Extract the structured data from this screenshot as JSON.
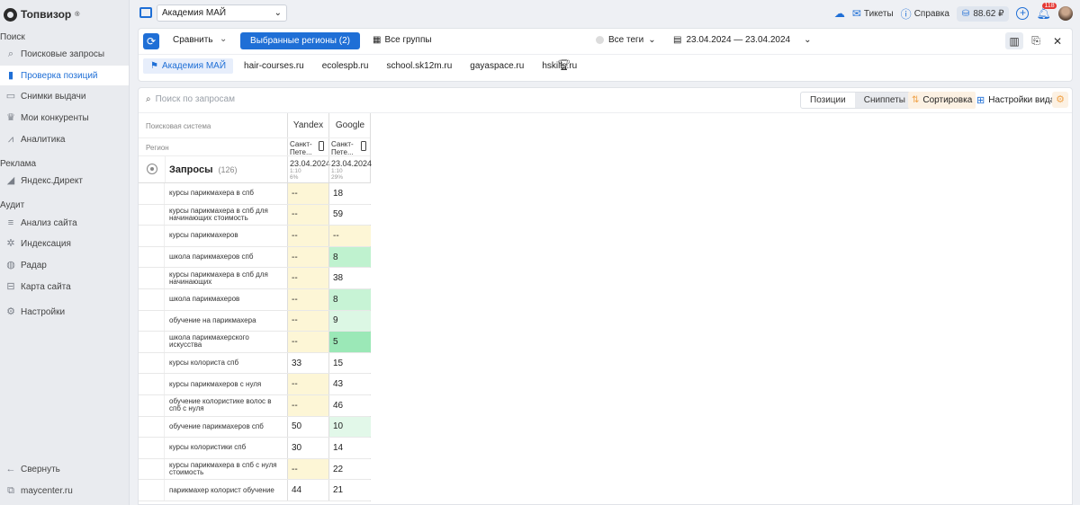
{
  "app": {
    "logo": "Топвизор",
    "logo_mark": "®"
  },
  "sidebar": {
    "sections": [
      {
        "label": "Поиск",
        "items": [
          {
            "label": "Поисковые запросы",
            "icon": "search-icon"
          },
          {
            "label": "Проверка позиций",
            "icon": "bar-chart-icon",
            "active": true
          },
          {
            "label": "Снимки выдачи",
            "icon": "snapshot-icon"
          },
          {
            "label": "Мои конкуренты",
            "icon": "trophy-icon"
          },
          {
            "label": "Аналитика",
            "icon": "analytics-icon"
          }
        ]
      },
      {
        "label": "Реклама",
        "items": [
          {
            "label": "Яндекс.Директ",
            "icon": "direct-icon"
          }
        ]
      },
      {
        "label": "Аудит",
        "items": [
          {
            "label": "Анализ сайта",
            "icon": "site-analysis-icon"
          },
          {
            "label": "Индексация",
            "icon": "indexing-icon"
          },
          {
            "label": "Радар",
            "icon": "radar-icon"
          },
          {
            "label": "Карта сайта",
            "icon": "sitemap-icon"
          }
        ]
      },
      {
        "label": "",
        "items": [
          {
            "label": "Настройки",
            "icon": "gear-icon"
          }
        ]
      }
    ],
    "collapse_label": "Свернуть",
    "site_label": "maycenter.ru"
  },
  "topbar": {
    "project": "Академия МАЙ",
    "tickets": "Тикеты",
    "help": "Справка",
    "balance": "88.62 ₽",
    "notifications": "118"
  },
  "toolbar": {
    "compare": "Сравнить",
    "regions": "Выбранные регионы",
    "regions_count": "(2)",
    "groups": "Все группы",
    "tags": "Все теги",
    "date_range": "23.04.2024 — 23.04.2024"
  },
  "project_tabs": [
    "Академия МАЙ",
    "hair-courses.ru",
    "ecolespb.ru",
    "school.sk12m.ru",
    "gayaspace.ru",
    "hskills.ru"
  ],
  "panel": {
    "search_placeholder": "Поиск по запросам",
    "seg_positions": "Позиции",
    "seg_snippets": "Сниппеты",
    "sorting": "Сортировка",
    "view_settings": "Настройки вида"
  },
  "table": {
    "header_engine": "Поисковая система",
    "header_region": "Регион",
    "engines": [
      "Yandex",
      "Google"
    ],
    "regions": [
      "Санкт-Пете...",
      "Санкт-Пете..."
    ],
    "dates": [
      "23.04.2024",
      "23.04.2024"
    ],
    "date_sub1": [
      "1:10",
      "1:10"
    ],
    "date_sub2": [
      "6%",
      "29%"
    ],
    "queries_title": "Запросы",
    "queries_count": "(126)",
    "rows": [
      {
        "q": "курсы парикмахера в спб",
        "y": "--",
        "g": "18",
        "yc": "#fdf6d6",
        "gc": "#ffffff"
      },
      {
        "q": "курсы парикмахера в спб для начинающих стоимость",
        "y": "--",
        "g": "59",
        "yc": "#fdf6d6",
        "gc": "#ffffff"
      },
      {
        "q": "курсы парикмахеров",
        "y": "--",
        "g": "--",
        "yc": "#fdf6d6",
        "gc": "#fdf6d6"
      },
      {
        "q": "школа парикмахеров спб",
        "y": "--",
        "g": "8",
        "yc": "#fdf6d6",
        "gc": "#bff2cf"
      },
      {
        "q": "курсы парикмахера в спб для начинающих",
        "y": "--",
        "g": "38",
        "yc": "#fdf6d6",
        "gc": "#ffffff"
      },
      {
        "q": "школа парикмахеров",
        "y": "--",
        "g": "8",
        "yc": "#fdf6d6",
        "gc": "#c7f3d5"
      },
      {
        "q": "обучение на парикмахера",
        "y": "--",
        "g": "9",
        "yc": "#fdf6d6",
        "gc": "#dcf7e4"
      },
      {
        "q": "школа парикмахерского искусства",
        "y": "--",
        "g": "5",
        "yc": "#fdf6d6",
        "gc": "#9be8b7"
      },
      {
        "q": "курсы колориста спб",
        "y": "33",
        "g": "15",
        "yc": "#ffffff",
        "gc": "#ffffff"
      },
      {
        "q": "курсы парикмахеров с нуля",
        "y": "--",
        "g": "43",
        "yc": "#fdf6d6",
        "gc": "#ffffff"
      },
      {
        "q": "обучение колористике волос в спб с нуля",
        "y": "--",
        "g": "46",
        "yc": "#fdf6d6",
        "gc": "#ffffff"
      },
      {
        "q": "обучение парикмахеров спб",
        "y": "50",
        "g": "10",
        "yc": "#ffffff",
        "gc": "#e2f8e9"
      },
      {
        "q": "курсы колористики спб",
        "y": "30",
        "g": "14",
        "yc": "#ffffff",
        "gc": "#ffffff"
      },
      {
        "q": "курсы парикмахера в спб с нуля стоимость",
        "y": "--",
        "g": "22",
        "yc": "#fdf6d6",
        "gc": "#ffffff"
      },
      {
        "q": "парикмахер колорист обучение",
        "y": "44",
        "g": "21",
        "yc": "#ffffff",
        "gc": "#ffffff"
      }
    ]
  },
  "colors": {
    "accent": "#1f6fd6",
    "yellow_cell": "#fdf6d6",
    "green_cell": "#bff2cf"
  }
}
